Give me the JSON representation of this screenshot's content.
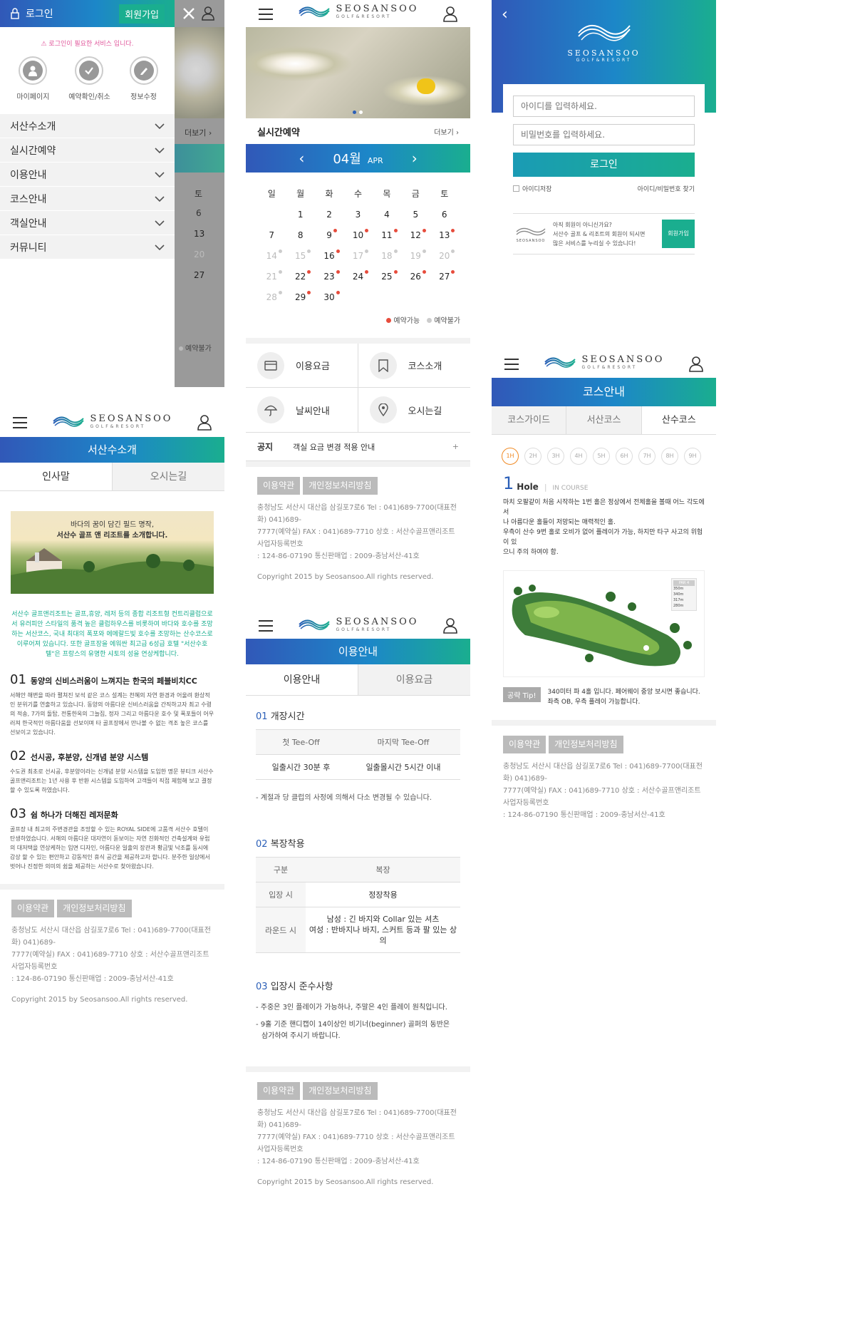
{
  "colors": {
    "accent": "#1c87c8",
    "green": "#1aae8f",
    "blue": "#3158b8",
    "red": "#e74c3c"
  },
  "brand": {
    "name": "SEOSANSOO",
    "sub": "GOLF&RESORT"
  },
  "menu": {
    "login": "로그인",
    "join": "회원가입",
    "notice": "로그인이 필요한 서비스 입니다.",
    "quick": [
      {
        "label": "마이페이지",
        "icon": "person-icon"
      },
      {
        "label": "예약확인/취소",
        "icon": "check-icon"
      },
      {
        "label": "정보수정",
        "icon": "pencil-icon"
      }
    ],
    "items": [
      "서산수소개",
      "실시간예약",
      "이용안내",
      "코스안내",
      "객실안내",
      "커뮤니티"
    ],
    "behind": {
      "more": "더보기 ›",
      "sat": "토",
      "d1": "6",
      "d2": "13",
      "d3": "20",
      "d4": "27",
      "legend": "예약불가"
    }
  },
  "home": {
    "section_title": "실시간예약",
    "more": "더보기 ›",
    "month": "04월",
    "month_en": "APR",
    "weekdays": [
      "일",
      "월",
      "화",
      "수",
      "목",
      "금",
      "토"
    ],
    "weeks": [
      [
        {
          "d": ""
        },
        {
          "d": "1"
        },
        {
          "d": "2"
        },
        {
          "d": "3"
        },
        {
          "d": "4"
        },
        {
          "d": "5"
        },
        {
          "d": "6"
        }
      ],
      [
        {
          "d": "7"
        },
        {
          "d": "8"
        },
        {
          "d": "9",
          "s": "r"
        },
        {
          "d": "10",
          "s": "r"
        },
        {
          "d": "11",
          "s": "r"
        },
        {
          "d": "12",
          "s": "r"
        },
        {
          "d": "13",
          "s": "r"
        }
      ],
      [
        {
          "d": "14",
          "s": "g",
          "f": 1
        },
        {
          "d": "15",
          "s": "g",
          "f": 1
        },
        {
          "d": "16",
          "s": "r"
        },
        {
          "d": "17",
          "s": "g",
          "f": 1
        },
        {
          "d": "18",
          "s": "g",
          "f": 1
        },
        {
          "d": "19",
          "s": "g",
          "f": 1
        },
        {
          "d": "20",
          "s": "g",
          "f": 1
        }
      ],
      [
        {
          "d": "21",
          "s": "g",
          "f": 1
        },
        {
          "d": "22",
          "s": "r"
        },
        {
          "d": "23",
          "s": "r"
        },
        {
          "d": "24",
          "s": "r"
        },
        {
          "d": "25",
          "s": "r"
        },
        {
          "d": "26",
          "s": "r"
        },
        {
          "d": "27",
          "s": "r"
        }
      ],
      [
        {
          "d": "28",
          "s": "g",
          "f": 1
        },
        {
          "d": "29",
          "s": "r"
        },
        {
          "d": "30",
          "s": "r"
        },
        {
          "d": ""
        },
        {
          "d": ""
        },
        {
          "d": ""
        },
        {
          "d": ""
        }
      ]
    ],
    "legend_ok": "예약가능",
    "legend_no": "예약불가",
    "quick": [
      {
        "label": "이용요금",
        "icon": "card-icon"
      },
      {
        "label": "코스소개",
        "icon": "bookmark-icon"
      },
      {
        "label": "날씨안내",
        "icon": "umbrella-icon"
      },
      {
        "label": "오시는길",
        "icon": "location-pin-icon"
      }
    ],
    "notice_label": "공지",
    "notice_text": "객실 요금 변경 적용 안내",
    "notice_plus": "+"
  },
  "login": {
    "id_placeholder": "아이디를 입력하세요.",
    "pw_placeholder": "비밀번호를 입력하세요.",
    "button": "로그인",
    "save_id": "아이디저장",
    "find": "아이디/비밀번호 찾기",
    "promo1": "아직 회원이 아니신가요?",
    "promo2": "서산수 골프 & 리조트의 회원이 되시면",
    "promo3": "많은 서비스를 누리실 수 있습니다!",
    "join": "회원가입"
  },
  "footer": {
    "terms": "이용약관",
    "privacy": "개인정보처리방침",
    "addr1": "충청남도 서산시 대산읍 삼길포7로6 Tel : 041)689-7700(대표전화) 041)689-",
    "addr2": "7777(예약실) FAX : 041)689-7710 상호 : 서산수골프앤리조트 사업자등록번호",
    "addr3": ": 124-86-07190 통신판매업 : 2009-충남서산-41호",
    "copy": "Copyright 2015 by Seosansoo.All rights reserved."
  },
  "intro": {
    "title": "서산수소개",
    "tabs": [
      "인사말",
      "오시는길"
    ],
    "cap1": "바다의 꿈이 담긴 필드 명작,",
    "cap2": "서산수 골프 앤 리조트를 소개합니다.",
    "desc": "서산수 골프앤리조트는 골프,휴양, 레저 등의 종합 리조트형 컨트리클럽으로서 유러피안 스타일의 품격 높은 클럽하우스를 비롯하여 바다와 호수를 조망하는 서산코스, 국내 최대의 폭포와 에메랄드빛 호수를 조망하는 산수코스로이루어져 있습니다. 또한 골프장을 에워싼 최고급 6성급 호텔 \"서산수호텔\"은 프랑스의 유명한 샤토의 성을 연상케합니다.",
    "sections": [
      {
        "num": "01",
        "title": "동양의 신비스러움이 느껴지는 한국의 페블비치CC",
        "body": "서해안 해변을 따라 펼쳐진 보석 같은 코스 설계는 천혜의 자연 환경과 어울려 환상적인 분위기를 연출하고 있습니다. 동양의 아름다운 신비스러움을 간직하고자 최고 수령의 적송, 7가의 돌탑, 전통한옥의 그늘집, 정자 그리고 아름다운 호수 및 폭포들이 어우러져 한국적인 아름다움을 선보이며 타 골프장에서 만나볼 수 없는 격조 높은 코스를 선보이고 있습니다."
      },
      {
        "num": "02",
        "title": "선시공, 후분양, 신개념 분양 시스템",
        "body": "수도권 최초로 선시공, 후분양이라는 신개념 분양 시스템을 도입한 명문 뷰티크 서산수 골프앤리조트는 1년 사용 후 반환 시스템을 도입하여 고객들이 직접 체험해 보고 결정 할 수 있도록 하였습니다."
      },
      {
        "num": "03",
        "title": "쉼 하나가 더해진 레저문화",
        "body": "골프장 내 최고의 주변경관을 조망할 수 있는 ROYAL SIDE에 고품격 서산수 호텔이 탄생하였습니다. 서해의 아름다운 대자연이 돋보이는 자연 친화적인 건축설계와 유럽의 대저택을 연상케하는 입면 디자인, 아름다운 일출의 장관과 황금빛 낙조를 동시에 감상 할 수 있는 편안하고 감동적인 휴식 공간을 제공하고자 합니다. 분주한 일상에서 벗어나 진정한 의미의 쉼을 제공하는 서산수로 찾아왔습니다."
      }
    ]
  },
  "guide": {
    "title": "이용안내",
    "tabs": [
      "이용안내",
      "이용요금"
    ],
    "s1": {
      "num": "01",
      "title": "개장시간",
      "h1": "첫 Tee-Off",
      "h2": "마지막 Tee-Off",
      "v1": "일출시간 30분 후",
      "v2": "일출몰시간 5시간 이내",
      "note": "- 계절과 당 클럽의 사정에 의해서 다소 변경될 수 있습니다."
    },
    "s2": {
      "num": "02",
      "title": "복장착용",
      "h1": "구분",
      "h2": "복장",
      "r1l": "입장 시",
      "r1v": "정장착용",
      "r2l": "라운드 시",
      "r2v1": "남성 : 긴 바지와 Collar 있는 셔츠",
      "r2v2": "여성 : 반바지나 바지, 스커트 등과 팔 있는 상의"
    },
    "s3": {
      "num": "03",
      "title": "입장시 준수사항",
      "l1": "- 주중은 3인 플레이가 가능하나, 주말은 4인 플레이 원칙입니다.",
      "l2": "- 9홀 기준 핸디캡이 14이상인 비기너(beginner) 골퍼의 동반은",
      "l3": "삼가하여 주시기 바랍니다."
    }
  },
  "course": {
    "title": "코스안내",
    "tabs": [
      "코스가이드",
      "서산코스",
      "산수코스"
    ],
    "holes": [
      "1H",
      "2H",
      "3H",
      "4H",
      "5H",
      "6H",
      "7H",
      "8H",
      "9H"
    ],
    "hole_num": "1",
    "hole_word": "Hole",
    "in_course": "IN COURSE",
    "desc": [
      "마치 오팔같이 처음 시작하는 1번 홀은 정상에서 전체홀을 볼때 어느 각도에서",
      "나 아름다운 홀들이 저망되는 매력적인 홀.",
      "우측이 산수 9번 홀로 오비가 없어 플레이가 가능, 하지만 타구 사고의 위험이 있",
      "으니 주의 하여야 함."
    ],
    "par": "PAR 4",
    "dist": [
      "350m",
      "340m",
      "317m",
      "280m"
    ],
    "tip_label": "공략 Tip!",
    "tip1": "340미터 파 4홀 입니다. 페어웨이 중앙 보시면 좋습니다.",
    "tip2": "좌측 OB, 우측 플레이 가능합니다."
  }
}
